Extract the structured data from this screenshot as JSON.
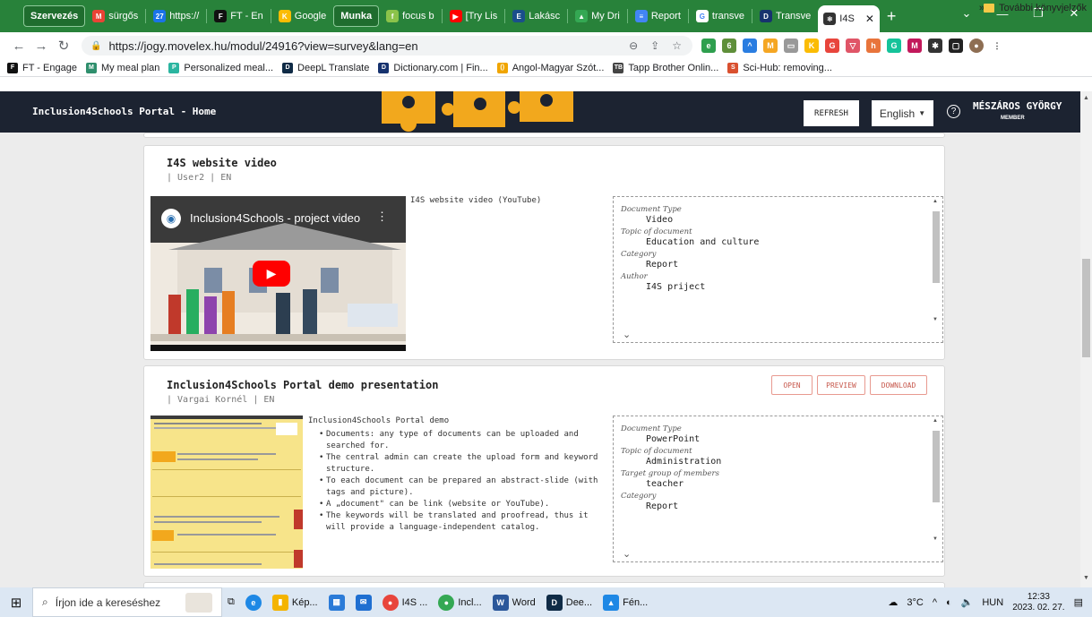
{
  "browser": {
    "tabs": [
      {
        "label": "Szervezés",
        "group": true
      },
      {
        "label": "sürgős",
        "icon": "gmail-icon",
        "color": "#ea4335"
      },
      {
        "label": "https://",
        "icon": "calendar-icon",
        "color": "#1a73e8"
      },
      {
        "label": "FT - En",
        "icon": "ft-icon",
        "color": "#111"
      },
      {
        "label": "Google",
        "icon": "keep-icon",
        "color": "#fbbc04"
      },
      {
        "label": "Munka",
        "group": true
      },
      {
        "label": "focus b",
        "icon": "focus-icon",
        "color": "#8bc34a"
      },
      {
        "label": "[Try Lis",
        "icon": "youtube-icon",
        "color": "#ff0000"
      },
      {
        "label": "Lakásc",
        "icon": "elte-icon",
        "color": "#1a4f8b"
      },
      {
        "label": "My Dri",
        "icon": "drive-icon",
        "color": "#34a853"
      },
      {
        "label": "Report",
        "icon": "forms-icon",
        "color": "#4285f4"
      },
      {
        "label": "transve",
        "icon": "google-icon",
        "color": "#4285f4"
      },
      {
        "label": "Transve",
        "icon": "dictionary-icon",
        "color": "#16326e"
      },
      {
        "label": "I4S",
        "icon": "react-icon",
        "color": "#333",
        "active": true
      }
    ],
    "url": "https://jogy.movelex.hu/modul/24916?view=survey&lang=en",
    "bookmarks": [
      {
        "label": "FT - Engage",
        "color": "#111"
      },
      {
        "label": "My meal plan",
        "color": "#2f8f6d"
      },
      {
        "label": "Personalized meal...",
        "color": "#2bb5a0"
      },
      {
        "label": "DeepL Translate",
        "color": "#0f2b46"
      },
      {
        "label": "Dictionary.com | Fin...",
        "color": "#16326e"
      },
      {
        "label": "Angol-Magyar Szót...",
        "color": "#f0a500"
      },
      {
        "label": "Tapp Brother Onlin...",
        "color": "#444"
      },
      {
        "label": "Sci-Hub: removing...",
        "color": "#d9502f"
      }
    ],
    "bookmarks_more": "»",
    "other_bookmarks": "További könyvjelzők"
  },
  "app": {
    "title": "Inclusion4Schools Portal - Home",
    "refresh_label": "REFRESH",
    "language": "English",
    "user_name": "MÉSZÁROS GYÖRGY",
    "user_role": "MEMBER"
  },
  "documents": [
    {
      "title": "I4S website video",
      "meta": "| User2 | EN",
      "description": "I4S website video (YouTube)",
      "video_title": "Inclusion4Schools - project video",
      "properties": [
        {
          "label": "Document Type",
          "value": "Video"
        },
        {
          "label": "Topic of document",
          "value": "Education and culture"
        },
        {
          "label": "Category",
          "value": "Report"
        },
        {
          "label": "Author",
          "value": "I4S priject"
        }
      ]
    },
    {
      "title": "Inclusion4Schools Portal demo presentation",
      "meta": "| Vargai Kornél | EN",
      "open_label": "OPEN",
      "preview_label": "PREVIEW",
      "download_label": "DOWNLOAD",
      "description_head": "Inclusion4Schools Portal demo",
      "bullets": [
        "Documents: any type of documents can be uploaded and searched for.",
        "The central admin can create the upload form and keyword structure.",
        "To each document can be prepared an abstract-slide (with tags and picture).",
        "A „document\" can be link (website or YouTube).",
        "The keywords will be translated and proofread, thus it will provide a language-independent catalog."
      ],
      "properties": [
        {
          "label": "Document Type",
          "value": "PowerPoint"
        },
        {
          "label": "Topic of document",
          "value": "Administration"
        },
        {
          "label": "Target group of members",
          "value": "teacher"
        },
        {
          "label": "Category",
          "value": "Report"
        }
      ]
    }
  ],
  "taskbar": {
    "search_placeholder": "Írjon ide a kereséshez",
    "apps": [
      {
        "label": "Kép...",
        "color": "#f4b400",
        "icon": "folder-icon"
      },
      {
        "label": "",
        "color": "#2b7bd8",
        "icon": "store-icon"
      },
      {
        "label": "",
        "color": "#1f6fd1",
        "icon": "mail-icon"
      },
      {
        "label": "I4S ...",
        "color": "#e8453c",
        "icon": "chrome-icon"
      },
      {
        "label": "Incl...",
        "color": "#34a853",
        "icon": "chrome-profile-icon"
      },
      {
        "label": "Word",
        "color": "#2b579a",
        "icon": "word-icon"
      },
      {
        "label": "Dee...",
        "color": "#0f2b46",
        "icon": "deepl-icon"
      },
      {
        "label": "Fén...",
        "color": "#1e88e5",
        "icon": "photos-icon"
      }
    ],
    "weather": "3°C",
    "language": "HUN",
    "time": "12:33",
    "date": "2023. 02. 27."
  }
}
